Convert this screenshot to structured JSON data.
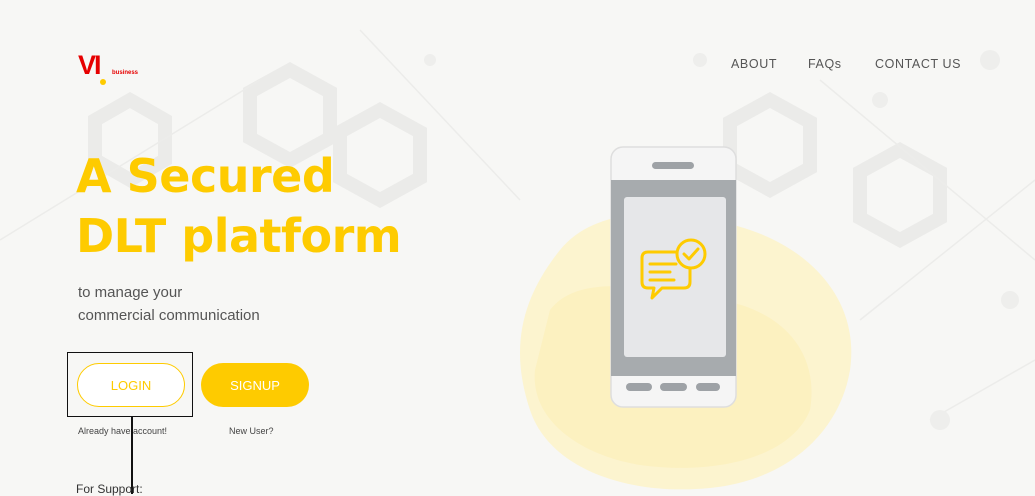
{
  "header": {
    "logo_text": "VI",
    "logo_word": "business",
    "nav": [
      {
        "label": "ABOUT"
      },
      {
        "label": "FAQs"
      },
      {
        "label": "CONTACT US"
      }
    ]
  },
  "hero": {
    "title_line1": "A Secured",
    "title_line2": "DLT platform",
    "subtitle_line1": "to manage your",
    "subtitle_line2": "commercial communication"
  },
  "actions": {
    "login_label": "LOGIN",
    "signup_label": "SIGNUP",
    "login_hint": "Already have account!",
    "signup_hint": "New User?"
  },
  "footer": {
    "support_label": "For Support:"
  },
  "colors": {
    "brand_red": "#e60000",
    "accent_yellow": "#fecb00"
  }
}
